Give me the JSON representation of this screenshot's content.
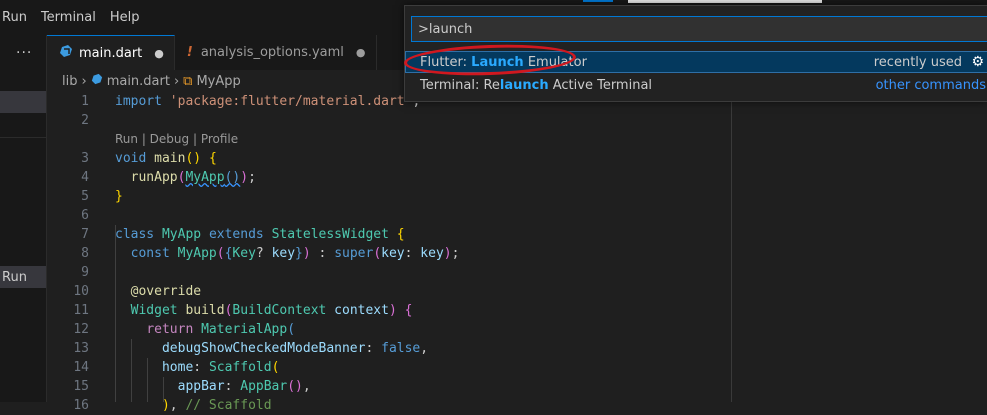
{
  "menu": [
    "Run",
    "Terminal",
    "Help"
  ],
  "sidebar": {
    "more_label": "···",
    "item_label": "Run"
  },
  "tabs": [
    {
      "label": "main.dart",
      "dirty": "●"
    },
    {
      "label": "analysis_options.yaml",
      "dirty": "●"
    }
  ],
  "breadcrumb": {
    "folder": "lib",
    "file": "main.dart",
    "symbol": "MyApp"
  },
  "editor": {
    "codelens": "Run | Debug | Profile",
    "line_numbers": [
      "1",
      "2",
      "3",
      "4",
      "5",
      "6",
      "7",
      "8",
      "9",
      "10",
      "11",
      "12",
      "13",
      "14",
      "15",
      "16"
    ]
  },
  "palette": {
    "query": ">launch",
    "items": [
      {
        "prefix": "Flutter: ",
        "match": "Launch",
        "suffix": " Emulator",
        "right": "recently used"
      },
      {
        "prefix": "Terminal: Re",
        "match": "launch",
        "suffix": " Active Terminal",
        "right": "other commands"
      }
    ]
  },
  "colors": {
    "accent": "#0078d4",
    "highlight_match": "#2aaaff",
    "annotation_red": "#d0181f",
    "selection_bg": "#04395e"
  },
  "icons": [
    "dart-file-icon",
    "warning-icon",
    "gear-icon",
    "chevron-right-icon",
    "more-icon"
  ]
}
